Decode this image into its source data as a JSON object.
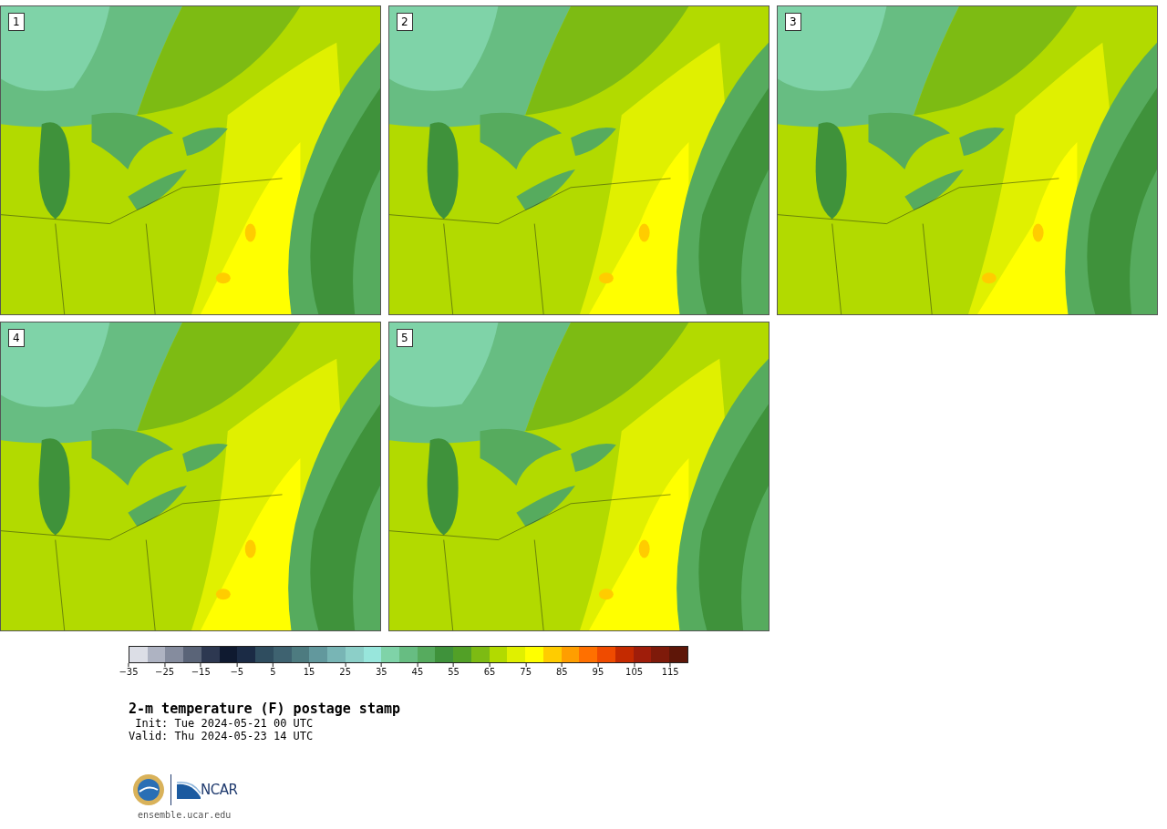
{
  "panels": [
    {
      "label": "1"
    },
    {
      "label": "2"
    },
    {
      "label": "3"
    },
    {
      "label": "4"
    },
    {
      "label": "5"
    }
  ],
  "colorbar": {
    "bins": [
      {
        "color": "#dcdee6"
      },
      {
        "color": "#aeb3c2"
      },
      {
        "color": "#858c9e"
      },
      {
        "color": "#5a6478"
      },
      {
        "color": "#2d3851"
      },
      {
        "color": "#0f1a30"
      },
      {
        "color": "#1b2b45"
      },
      {
        "color": "#2f4d5f"
      },
      {
        "color": "#3e6270"
      },
      {
        "color": "#4d7b80"
      },
      {
        "color": "#62989d"
      },
      {
        "color": "#78b5b5"
      },
      {
        "color": "#8ccfc8"
      },
      {
        "color": "#98e6dc"
      },
      {
        "color": "#7fd3a8"
      },
      {
        "color": "#67bd82"
      },
      {
        "color": "#56ab5e"
      },
      {
        "color": "#3f923b"
      },
      {
        "color": "#52a027"
      },
      {
        "color": "#7dbb13"
      },
      {
        "color": "#b2da00"
      },
      {
        "color": "#e0f000"
      },
      {
        "color": "#ffff00"
      },
      {
        "color": "#ffcc00"
      },
      {
        "color": "#ff9e00"
      },
      {
        "color": "#ff7000"
      },
      {
        "color": "#ef4b00"
      },
      {
        "color": "#c42a00"
      },
      {
        "color": "#9f1d0a"
      },
      {
        "color": "#7e1a0a"
      },
      {
        "color": "#5e1608"
      }
    ],
    "ticks": [
      "−35",
      "−25",
      "−15",
      "−5",
      "5",
      "15",
      "25",
      "35",
      "45",
      "55",
      "65",
      "75",
      "85",
      "95",
      "105",
      "115"
    ]
  },
  "title": "2-m temperature (F) postage stamp",
  "init": " Init: Tue 2024-05-21 00 UTC",
  "valid": "Valid: Thu 2024-05-23 14 UTC",
  "logo_text": "NCAR",
  "url": "ensemble.ucar.edu"
}
